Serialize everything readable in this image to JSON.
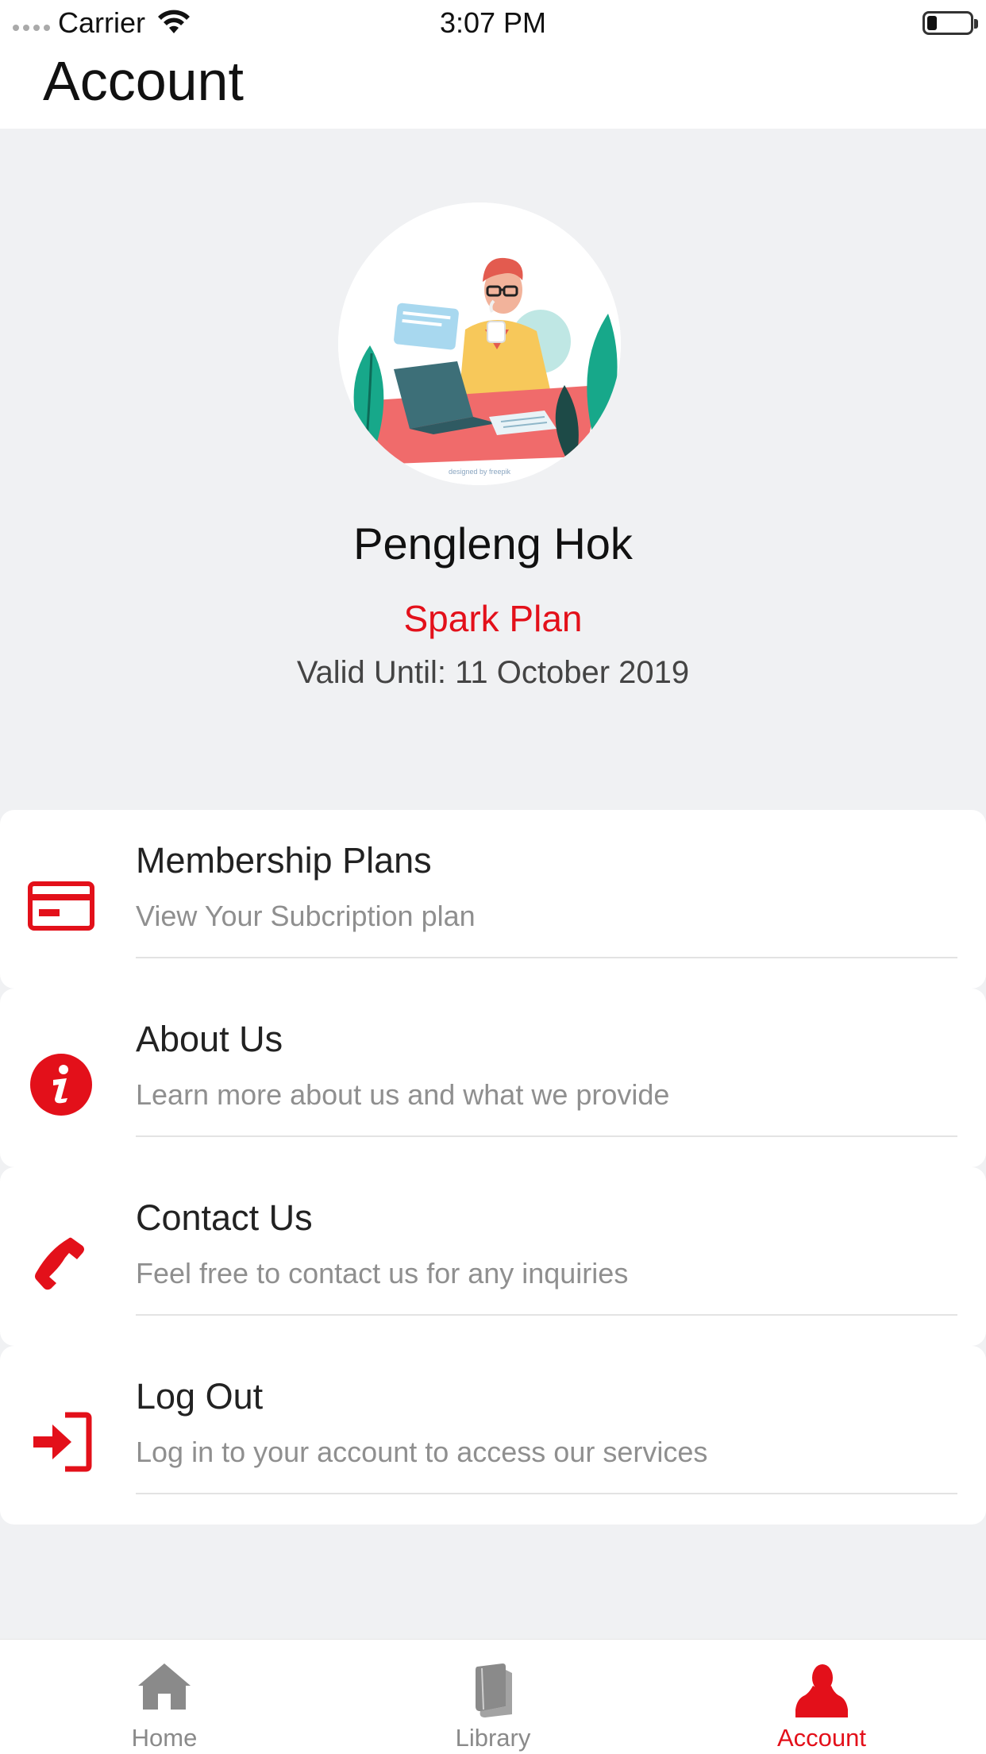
{
  "status_bar": {
    "carrier": "Carrier",
    "time": "3:07 PM"
  },
  "header": {
    "title": "Account"
  },
  "profile": {
    "avatar_credit": "designed by freepik",
    "name": "Pengleng Hok",
    "plan": "Spark Plan",
    "valid_until": "Valid Until: 11 October 2019"
  },
  "menu": {
    "items": [
      {
        "title": "Membership Plans",
        "subtitle": "View Your Subcription plan",
        "icon": "credit-card-icon"
      },
      {
        "title": "About Us",
        "subtitle": "Learn more about us and what we provide",
        "icon": "info-icon"
      },
      {
        "title": "Contact Us",
        "subtitle": "Feel free to contact us for any inquiries",
        "icon": "phone-icon"
      },
      {
        "title": "Log Out",
        "subtitle": "Log in to your account to access our services",
        "icon": "sign-in-icon"
      }
    ]
  },
  "tab_bar": {
    "tabs": [
      {
        "label": "Home",
        "icon": "home-icon",
        "active": false
      },
      {
        "label": "Library",
        "icon": "book-icon",
        "active": false
      },
      {
        "label": "Account",
        "icon": "user-icon",
        "active": true
      }
    ]
  },
  "colors": {
    "accent": "#e3101a",
    "background": "#f0f1f3",
    "inactive_tab": "#8a8a8a"
  }
}
